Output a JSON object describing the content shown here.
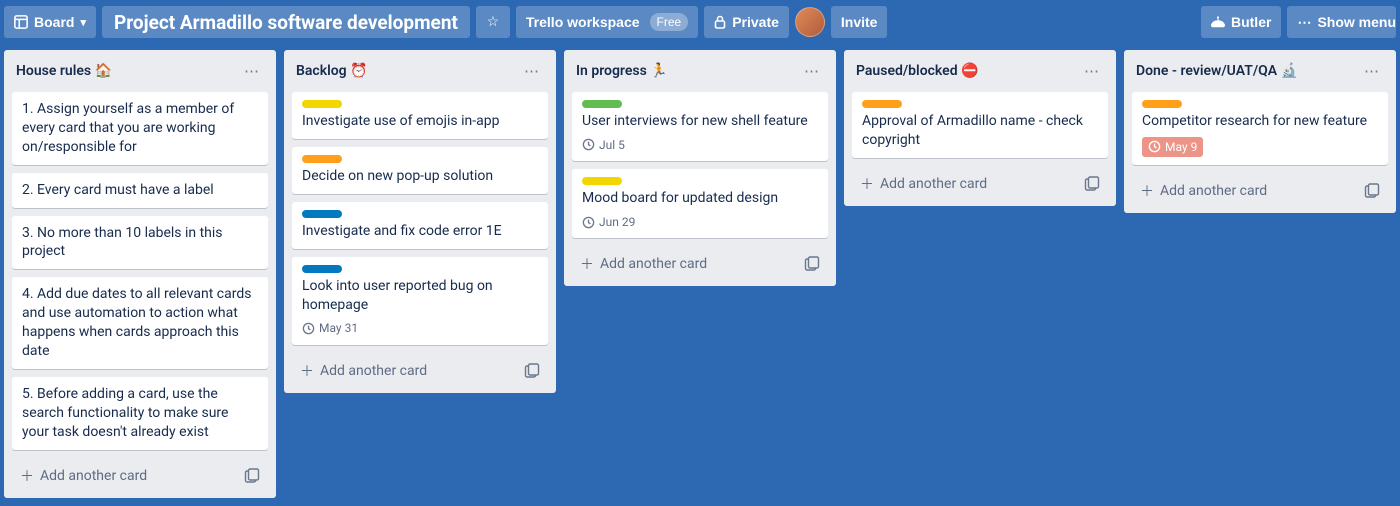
{
  "topbar": {
    "board_button": "Board",
    "title": "Project Armadillo software development",
    "workspace": "Trello workspace",
    "workspace_badge": "Free",
    "visibility": "Private",
    "invite": "Invite",
    "butler": "Butler",
    "show_menu": "Show menu"
  },
  "add_card_label": "Add another card",
  "lists": [
    {
      "title": "House rules 🏠",
      "cards": [
        {
          "labels": [],
          "text": "1. Assign yourself as a member of every card that you are working on/responsible for"
        },
        {
          "labels": [],
          "text": "2. Every card must have a label"
        },
        {
          "labels": [],
          "text": "3. No more than 10 labels in this project"
        },
        {
          "labels": [],
          "text": "4. Add due dates to all relevant cards and use automation to action what happens when cards approach this date"
        },
        {
          "labels": [],
          "text": "5. Before adding a card, use the search functionality to make sure your task doesn't already exist"
        }
      ]
    },
    {
      "title": "Backlog ⏰",
      "cards": [
        {
          "labels": [
            "yellow"
          ],
          "text": "Investigate use of emojis in-app"
        },
        {
          "labels": [
            "orange"
          ],
          "text": "Decide on new pop-up solution"
        },
        {
          "labels": [
            "blue"
          ],
          "text": "Investigate and fix code error 1E"
        },
        {
          "labels": [
            "blue"
          ],
          "text": "Look into user reported bug on homepage",
          "due": "May 31"
        }
      ]
    },
    {
      "title": "In progress 🏃",
      "cards": [
        {
          "labels": [
            "green"
          ],
          "text": "User interviews for new shell feature",
          "due": "Jul 5"
        },
        {
          "labels": [
            "yellow"
          ],
          "text": "Mood board for updated design",
          "due": "Jun 29"
        }
      ]
    },
    {
      "title": "Paused/blocked ⛔",
      "cards": [
        {
          "labels": [
            "orange"
          ],
          "text": "Approval of Armadillo name - check copyright"
        }
      ]
    },
    {
      "title": "Done - review/UAT/QA 🔬",
      "cards": [
        {
          "labels": [
            "orange"
          ],
          "text": "Competitor research for new feature",
          "due": "May 9",
          "overdue": true
        }
      ]
    }
  ]
}
